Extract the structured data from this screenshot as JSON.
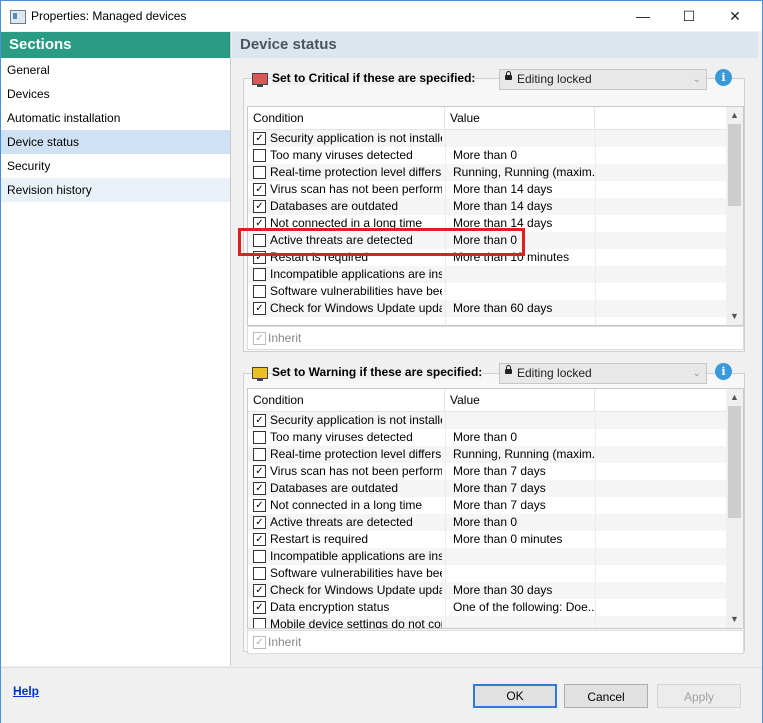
{
  "window": {
    "title": "Properties: Managed devices"
  },
  "sidebar": {
    "header": "Sections",
    "items": [
      {
        "label": "General"
      },
      {
        "label": "Devices"
      },
      {
        "label": "Automatic installation"
      },
      {
        "label": "Device status"
      },
      {
        "label": "Security"
      },
      {
        "label": "Revision history"
      }
    ],
    "selected": "Device status"
  },
  "main": {
    "title": "Device status",
    "critical": {
      "label": "Set to Critical if these are specified:",
      "lock_label": "Editing locked",
      "monitor_color": "#e05555",
      "columns": [
        "Condition",
        "Value"
      ],
      "rows": [
        {
          "checked": true,
          "condition": "Security application is not installed",
          "value": ""
        },
        {
          "checked": false,
          "condition": "Too many viruses detected",
          "value": "More than 0"
        },
        {
          "checked": false,
          "condition": "Real-time protection level differs ...",
          "value": "Running, Running (maxim..."
        },
        {
          "checked": true,
          "condition": "Virus scan has not been performe...",
          "value": "More than 14 days"
        },
        {
          "checked": true,
          "condition": "Databases are outdated",
          "value": "More than 14 days"
        },
        {
          "checked": true,
          "condition": "Not connected in a long time",
          "value": "More than 14 days"
        },
        {
          "checked": false,
          "condition": "Active threats are detected",
          "value": "More than 0"
        },
        {
          "checked": true,
          "condition": "Restart is required",
          "value": "More than 10 minutes"
        },
        {
          "checked": false,
          "condition": "Incompatible applications are inst...",
          "value": ""
        },
        {
          "checked": false,
          "condition": "Software vulnerabilities have bee...",
          "value": ""
        },
        {
          "checked": true,
          "condition": "Check for Windows Update updat...",
          "value": "More than 60 days"
        }
      ],
      "inherit_label": "Inherit"
    },
    "warning": {
      "label": "Set to Warning if these are specified:",
      "lock_label": "Editing locked",
      "monitor_color": "#e8c020",
      "columns": [
        "Condition",
        "Value"
      ],
      "rows": [
        {
          "checked": true,
          "condition": "Security application is not installed",
          "value": ""
        },
        {
          "checked": false,
          "condition": "Too many viruses detected",
          "value": "More than 0"
        },
        {
          "checked": false,
          "condition": "Real-time protection level differs ...",
          "value": "Running, Running (maxim..."
        },
        {
          "checked": true,
          "condition": "Virus scan has not been performe...",
          "value": "More than 7 days"
        },
        {
          "checked": true,
          "condition": "Databases are outdated",
          "value": "More than 7 days"
        },
        {
          "checked": true,
          "condition": "Not connected in a long time",
          "value": "More than 7 days"
        },
        {
          "checked": true,
          "condition": "Active threats are detected",
          "value": "More than 0"
        },
        {
          "checked": true,
          "condition": "Restart is required",
          "value": "More than 0 minutes"
        },
        {
          "checked": false,
          "condition": "Incompatible applications are inst...",
          "value": ""
        },
        {
          "checked": false,
          "condition": "Software vulnerabilities have bee...",
          "value": ""
        },
        {
          "checked": true,
          "condition": "Check for Windows Update updat...",
          "value": "More than 30 days"
        },
        {
          "checked": true,
          "condition": "Data encryption status",
          "value": "One of the following: Doe..."
        },
        {
          "checked": false,
          "condition": "Mobile device settings do not com...",
          "value": ""
        }
      ],
      "inherit_label": "Inherit"
    }
  },
  "footer": {
    "help": "Help",
    "ok": "OK",
    "cancel": "Cancel",
    "apply": "Apply"
  },
  "colors": {
    "accent": "#2b9c84",
    "highlight": "#e02020",
    "selected": "#cfe2f5"
  }
}
